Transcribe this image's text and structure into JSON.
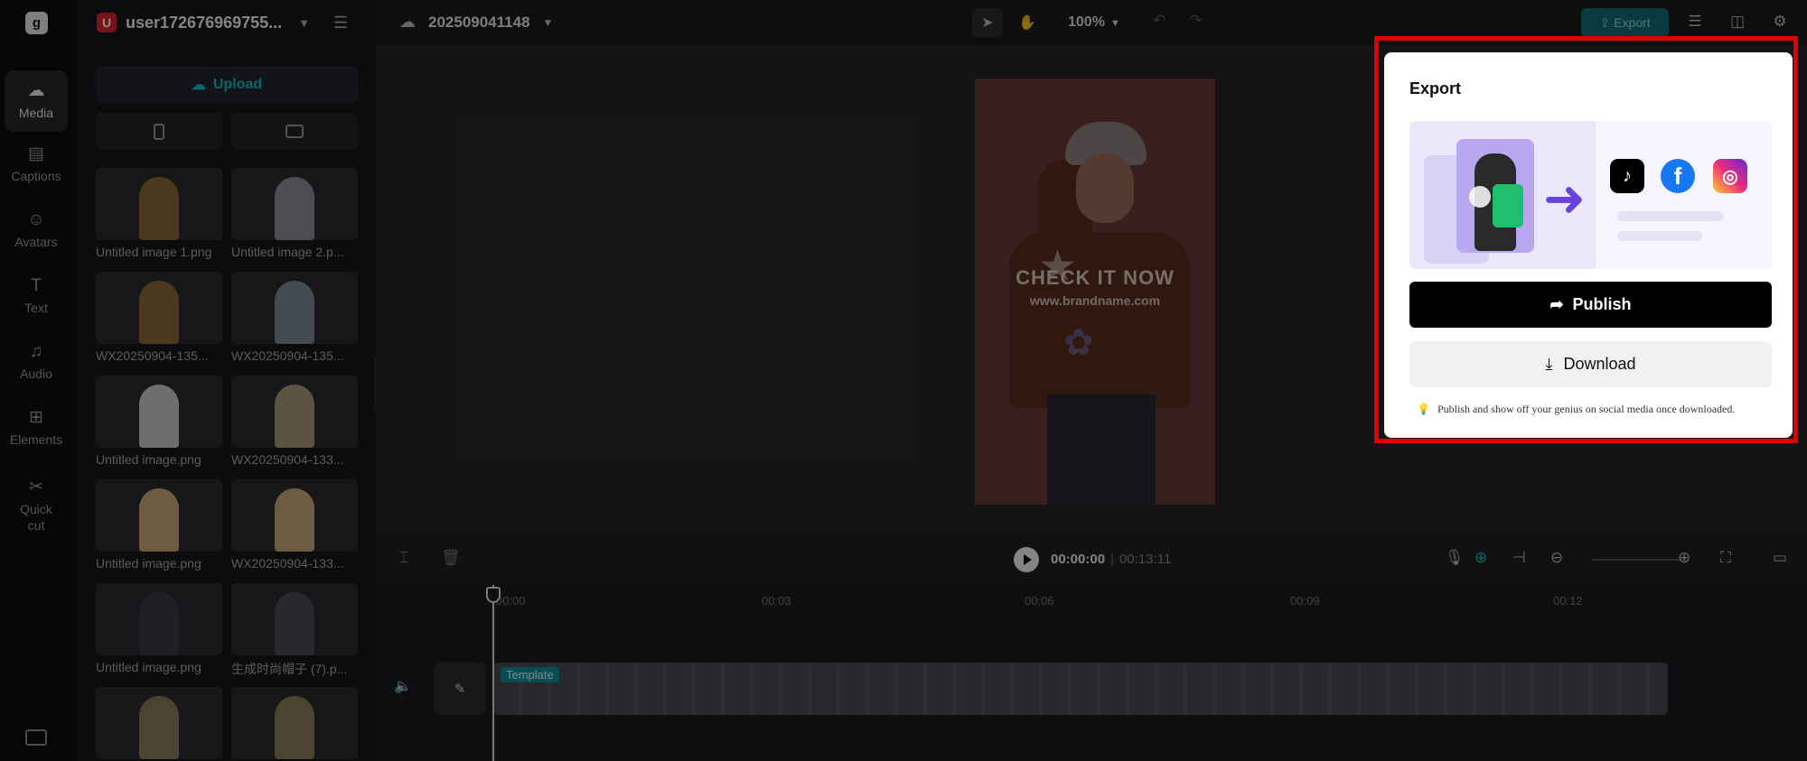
{
  "rail": {
    "items": [
      {
        "label": "Media",
        "icon": "upload-cloud-icon",
        "glyph": "☁"
      },
      {
        "label": "Captions",
        "icon": "captions-icon",
        "glyph": "▤"
      },
      {
        "label": "Avatars",
        "icon": "avatar-icon",
        "glyph": "☺"
      },
      {
        "label": "Text",
        "icon": "text-icon",
        "glyph": "T"
      },
      {
        "label": "Audio",
        "icon": "music-icon",
        "glyph": "♫"
      },
      {
        "label": "Elements",
        "icon": "elements-icon",
        "glyph": "⊞"
      },
      {
        "label": "Quick cut",
        "icon": "scissors-icon",
        "glyph": "✂"
      }
    ]
  },
  "panel": {
    "user_initial": "U",
    "username": "user172676969755...",
    "upload_label": "Upload",
    "media": [
      {
        "name": "Untitled image 1.png",
        "color": "#8a6a3a"
      },
      {
        "name": "Untitled image 2.p...",
        "color": "#8a8e96"
      },
      {
        "name": "WX20250904-135...",
        "color": "#8a6a3a"
      },
      {
        "name": "WX20250904-135...",
        "color": "#7a8a96"
      },
      {
        "name": "Untitled image.png",
        "color": "#c8c8c8"
      },
      {
        "name": "WX20250904-133...",
        "color": "#a89878"
      },
      {
        "name": "Untitled image.png",
        "color": "#c8a878"
      },
      {
        "name": "WX20250904-133...",
        "color": "#c8a878"
      },
      {
        "name": "Untitled image.png",
        "color": "#3a3a44"
      },
      {
        "name": "生成时尚帽子 (7).p...",
        "color": "#4a4a54"
      },
      {
        "name": "",
        "color": "#8a7a5a"
      },
      {
        "name": "",
        "color": "#8a7a5a"
      }
    ]
  },
  "topbar": {
    "project_name": "202509041148",
    "zoom": "100%",
    "export_label": "Export"
  },
  "video": {
    "cta": "CHECK IT NOW",
    "url": "www.brandname.com"
  },
  "playback": {
    "current": "00:00:00",
    "duration": "00:13:11"
  },
  "timeline": {
    "ticks": [
      "00:00",
      "00:03",
      "00:06",
      "00:09",
      "00:12"
    ],
    "clip_label": "Template"
  },
  "export_panel": {
    "title": "Export",
    "publish_label": "Publish",
    "download_label": "Download",
    "tip": "Publish and show off your genius on social media once downloaded."
  }
}
